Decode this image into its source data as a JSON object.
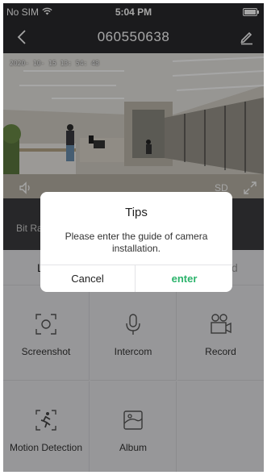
{
  "status_bar": {
    "carrier": "No SIM",
    "time": "5:04 PM",
    "wifi_icon": "wifi-icon",
    "battery_icon": "battery-icon"
  },
  "nav": {
    "title": "060550638",
    "back_icon": "chevron-left-icon",
    "edit_icon": "pencil-icon"
  },
  "video": {
    "timestamp": "2020- 10- 15  13: 54: 48",
    "quality": "SD",
    "speaker_icon": "speaker-icon",
    "fullscreen_icon": "expand-icon"
  },
  "bitrate": {
    "label": "Bit Ra"
  },
  "tabs": {
    "left_fragment": "L",
    "right_fragment": "d"
  },
  "functions": [
    {
      "label": "Screenshot",
      "icon": "screenshot-icon"
    },
    {
      "label": "Intercom",
      "icon": "microphone-icon"
    },
    {
      "label": "Record",
      "icon": "record-icon"
    },
    {
      "label": "Motion Detection",
      "icon": "motion-detection-icon"
    },
    {
      "label": "Album",
      "icon": "album-icon"
    }
  ],
  "dialog": {
    "title": "Tips",
    "message": "Please enter the guide of camera installation.",
    "cancel_label": "Cancel",
    "confirm_label": "enter",
    "confirm_color": "#2bb36b"
  },
  "colors": {
    "header_bg": "#2a2a2d",
    "panel_bg": "#e9e9ec",
    "accent": "#2bb36b"
  }
}
